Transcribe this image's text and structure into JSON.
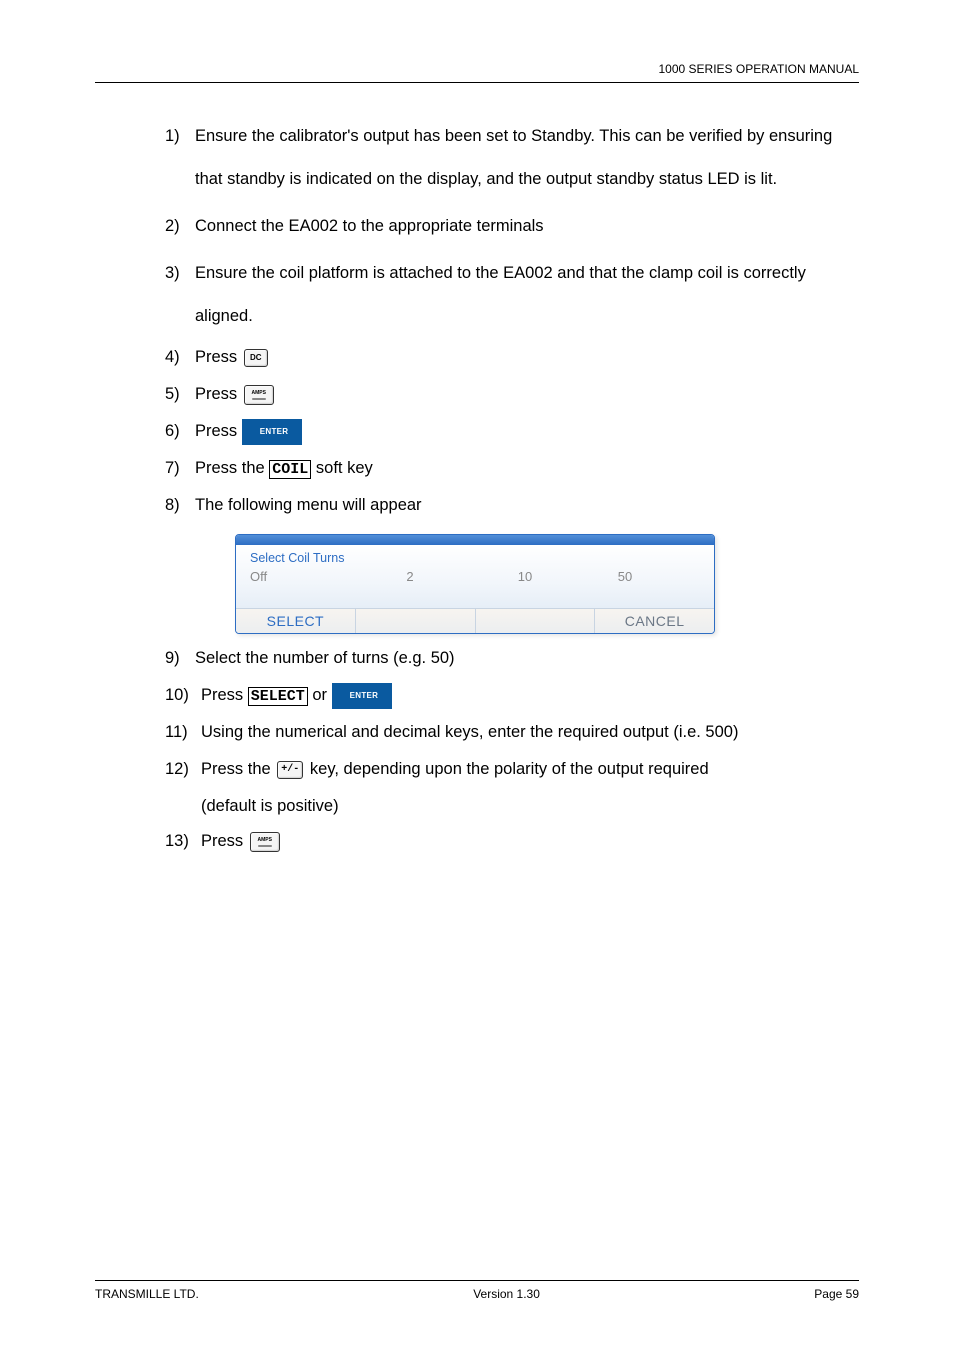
{
  "header": {
    "title": "1000 SERIES OPERATION MANUAL"
  },
  "steps": {
    "s1": "Ensure the calibrator's output has been set to Standby. This can be verified by ensuring that standby is indicated on the display, and the output standby status LED is lit.",
    "s2": "Connect the EA002 to the appropriate terminals",
    "s3": "Ensure the coil platform is attached to the EA002 and that the clamp coil is correctly aligned.",
    "s4_prefix": "Press ",
    "s5_prefix": "Press ",
    "s6_prefix": "Press ",
    "s7_a": "Press the ",
    "s7_code": "COIL",
    "s7_b": " soft key",
    "s8": "The following menu will appear",
    "s9": "Select the number of turns (e.g. 50)",
    "s10_a": "Press ",
    "s10_code": "SELECT",
    "s10_b": " or ",
    "s11": "Using the numerical and decimal keys, enter the required output (i.e. 500)",
    "s12_a": "Press the ",
    "s12_b": " key, depending upon the polarity of the output required",
    "s12_c": "(default is positive)",
    "s13_prefix": "Press "
  },
  "keys": {
    "dc": "DC",
    "amps": "AMPS",
    "enter": "ENTER",
    "plusminus": "+/-"
  },
  "panel": {
    "title": "Select Coil Turns",
    "opts": [
      "Off",
      "2",
      "10",
      "50"
    ],
    "btn_select": "SELECT",
    "btn_cancel": "CANCEL"
  },
  "nums": {
    "n1": "1)",
    "n2": "2)",
    "n3": "3)",
    "n4": "4)",
    "n5": "5)",
    "n6": "6)",
    "n7": "7)",
    "n8": "8)",
    "n9": "9)",
    "n10": "10)",
    "n11": "11)",
    "n12": "12)",
    "n13": "13)"
  },
  "footer": {
    "left": "TRANSMILLE LTD.",
    "center": "Version 1.30",
    "right": "Page 59"
  }
}
